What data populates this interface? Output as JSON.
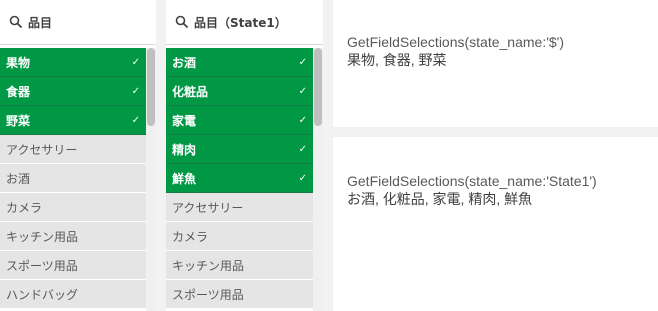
{
  "listbox1": {
    "title": "品目",
    "items": [
      {
        "label": "果物",
        "selected": true
      },
      {
        "label": "食器",
        "selected": true
      },
      {
        "label": "野菜",
        "selected": true
      },
      {
        "label": "アクセサリー",
        "selected": false
      },
      {
        "label": "お酒",
        "selected": false
      },
      {
        "label": "カメラ",
        "selected": false
      },
      {
        "label": "キッチン用品",
        "selected": false
      },
      {
        "label": "スポーツ用品",
        "selected": false
      },
      {
        "label": "ハンドバッグ",
        "selected": false
      }
    ]
  },
  "listbox2": {
    "title": "品目（State1）",
    "items": [
      {
        "label": "お酒",
        "selected": true
      },
      {
        "label": "化粧品",
        "selected": true
      },
      {
        "label": "家電",
        "selected": true
      },
      {
        "label": "精肉",
        "selected": true
      },
      {
        "label": "鮮魚",
        "selected": true
      },
      {
        "label": "アクセサリー",
        "selected": false
      },
      {
        "label": "カメラ",
        "selected": false
      },
      {
        "label": "キッチン用品",
        "selected": false
      },
      {
        "label": "スポーツ用品",
        "selected": false
      }
    ]
  },
  "kpi1": {
    "expression": "GetFieldSelections(state_name:'$')",
    "value": "果物, 食器, 野菜"
  },
  "kpi2": {
    "expression": "GetFieldSelections(state_name:'State1')",
    "value": "お酒, 化粧品, 家電, 精肉, 鮮魚"
  },
  "icons": {
    "search": "search-icon",
    "check": "check-icon"
  },
  "colors": {
    "selected": "#009845",
    "alternative": "#e5e5e5",
    "text": "#595959"
  }
}
